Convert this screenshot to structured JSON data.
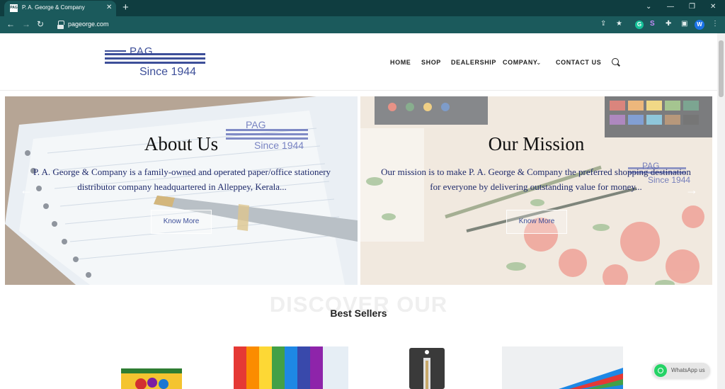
{
  "browser": {
    "tab_favicon": "PAG",
    "tab_title": "P. A. George & Company",
    "url": "pageorge.com",
    "profile_initial": "W",
    "grammarly_letter": "G"
  },
  "logo": {
    "mark": "PAG",
    "since": "Since 1944"
  },
  "nav": {
    "home": "HOME",
    "shop": "SHOP",
    "dealership": "DEALERSHIP",
    "company": "COMPANY",
    "contact": "CONTACT US"
  },
  "slides": [
    {
      "title": "About Us",
      "text": "P. A. George & Company is a family-owned and operated paper/office stationery distributor company headquartered in Alleppey, Kerala...",
      "button": "Know More",
      "watermark_mark": "PAG",
      "watermark_since": "Since 1944"
    },
    {
      "title": "Our Mission",
      "text": "Our mission is to make P. A. George & Company the preferred shopping destination for everyone by delivering outstanding value for money...",
      "button": "Know More",
      "watermark_mark": "PAG",
      "watermark_since": "Since 1944"
    }
  ],
  "discover": {
    "background": "DISCOVER OUR",
    "heading": "Best Sellers"
  },
  "whatsapp": {
    "label": "WhatsApp us"
  },
  "colors": {
    "chrome_dark": "#0f3d40",
    "chrome": "#1b5a5c",
    "brand": "#3d4f99",
    "whatsapp": "#25d366"
  }
}
